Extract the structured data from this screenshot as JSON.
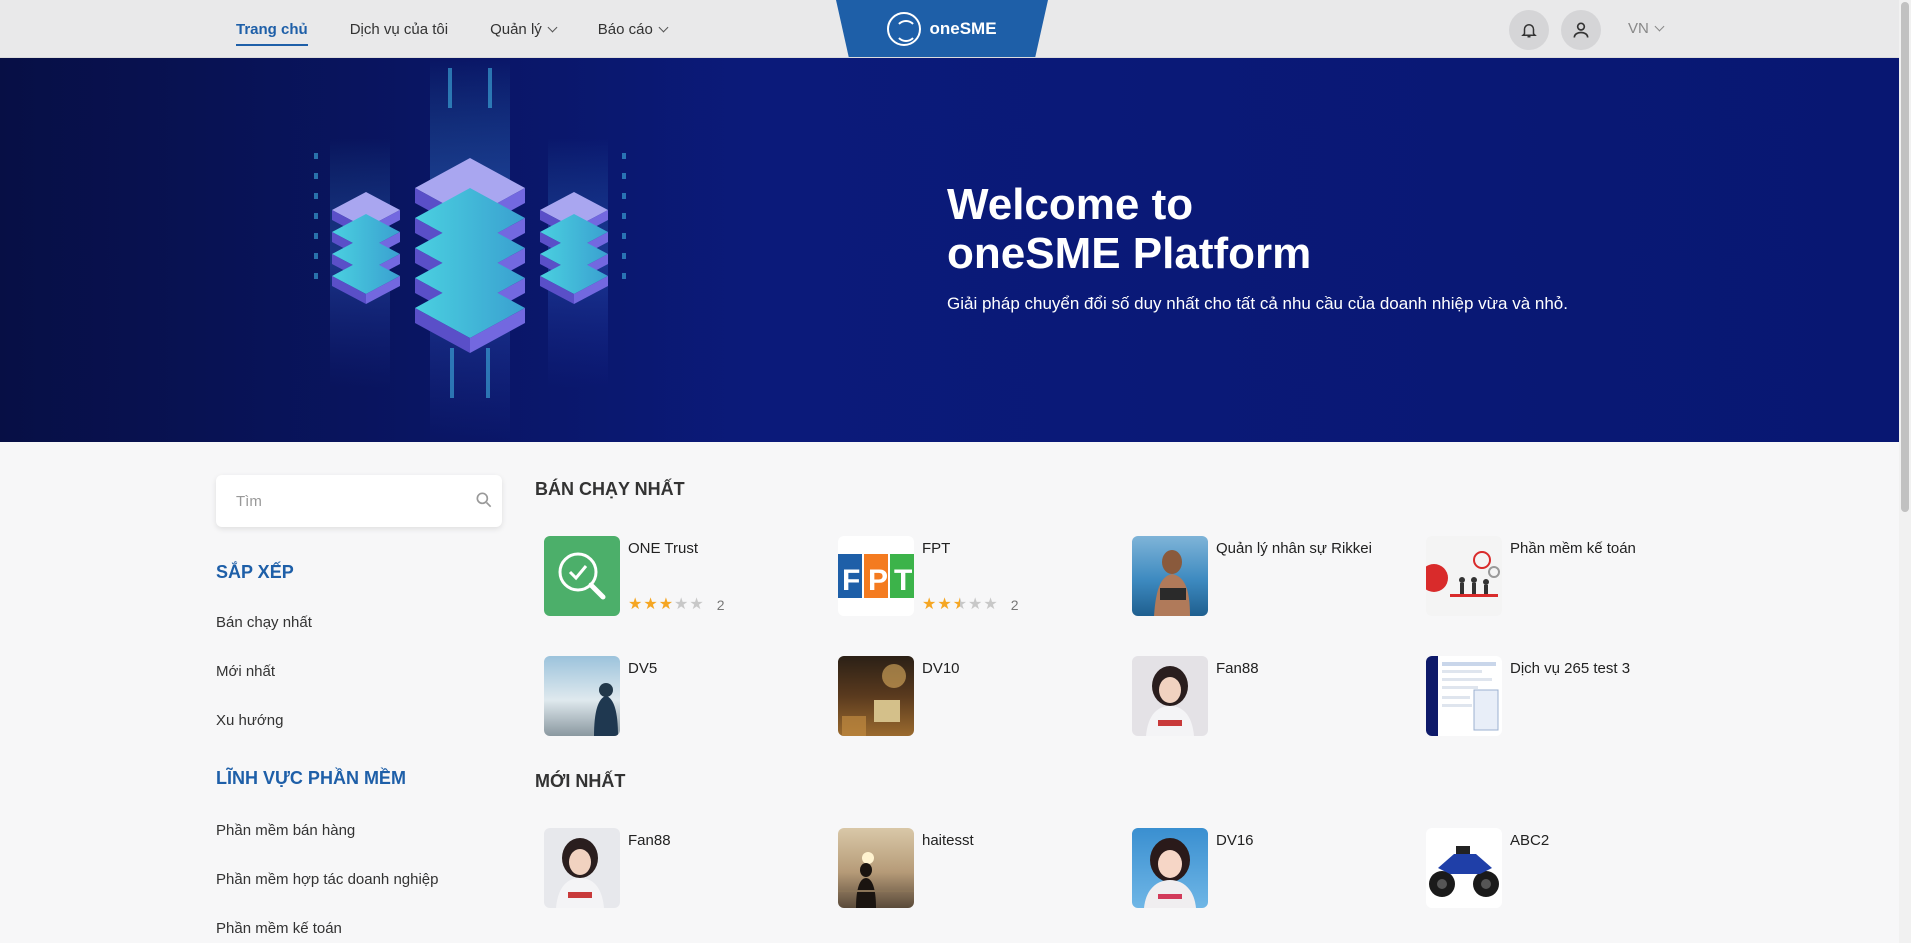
{
  "header": {
    "nav": [
      {
        "label": "Trang chủ",
        "active": true
      },
      {
        "label": "Dịch vụ của tôi"
      },
      {
        "label": "Quản lý",
        "dropdown": true
      },
      {
        "label": "Báo cáo",
        "dropdown": true
      }
    ],
    "logo": "oneSME",
    "language": "VN"
  },
  "hero": {
    "title_line1": "Welcome to",
    "title_line2": "oneSME Platform",
    "subtitle": "Giải pháp chuyển đổi số duy nhất cho tất cả nhu cầu của doanh nhiệp vừa và nhỏ."
  },
  "sidebar": {
    "search_placeholder": "Tìm",
    "sort_heading": "SẮP XẾP",
    "sort_items": [
      "Bán chạy nhất",
      "Mới nhất",
      "Xu hướng"
    ],
    "category_heading": "LĨNH VỰC PHẦN MỀM",
    "category_items": [
      "Phần mềm bán hàng",
      "Phần mềm hợp tác doanh nghiệp",
      "Phần mềm kế toán"
    ]
  },
  "best_selling": {
    "title": "BÁN CHẠY NHẤT",
    "items": [
      {
        "name": "ONE Trust",
        "rating": 3,
        "reviews": "2",
        "thumb": "one-trust-logo"
      },
      {
        "name": "FPT",
        "rating": 2.5,
        "reviews": "2",
        "thumb": "fpt-logo"
      },
      {
        "name": "Quản lý nhân sự Rikkei",
        "thumb": "photo-beach"
      },
      {
        "name": "Phần mềm kế toán",
        "thumb": "photo-illustration"
      },
      {
        "name": "DV5",
        "thumb": "photo-sky"
      },
      {
        "name": "DV10",
        "thumb": "photo-night"
      },
      {
        "name": "Fan88",
        "thumb": "photo-girl"
      },
      {
        "name": "Dịch vụ 265 test 3",
        "thumb": "photo-screenshot"
      }
    ]
  },
  "newest": {
    "title": "MỚI NHẤT",
    "items": [
      {
        "name": "Fan88",
        "thumb": "photo-girl"
      },
      {
        "name": "haitesst",
        "thumb": "photo-sunset"
      },
      {
        "name": "DV16",
        "thumb": "photo-girl-2"
      },
      {
        "name": "ABC2",
        "thumb": "photo-atv"
      }
    ]
  },
  "colors": {
    "primary": "#1e5fa8",
    "hero_bg": "#0b1a7a",
    "star": "#f5a623"
  }
}
